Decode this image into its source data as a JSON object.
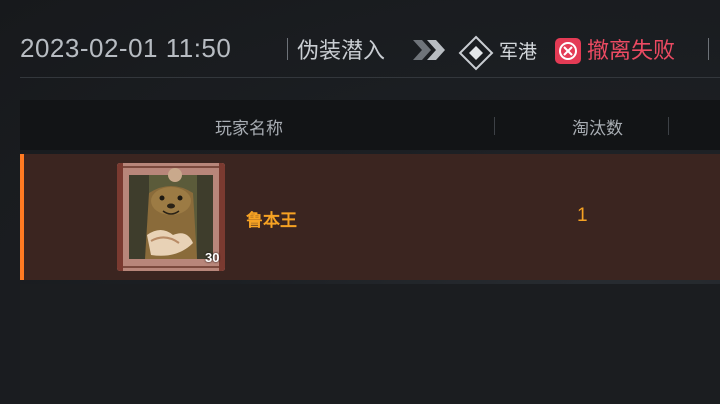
{
  "header": {
    "timestamp": "2023-02-01 11:50",
    "mode": "伪装潜入",
    "map": "军港",
    "result": "撤离失败",
    "result_color": "#ec4a62",
    "icons": [
      "chevrons-right-icon",
      "diamond-map-icon",
      "failure-icon"
    ]
  },
  "table": {
    "columns": [
      "玩家名称",
      "淘汰数"
    ],
    "rows": [
      {
        "name": "鲁本王",
        "level": "30",
        "kills": "1",
        "avatar": "otter-avatar"
      }
    ]
  },
  "colors": {
    "accent": "#ff7a22",
    "highlight_text": "#f6a223",
    "row_bg": "#3b2520"
  }
}
